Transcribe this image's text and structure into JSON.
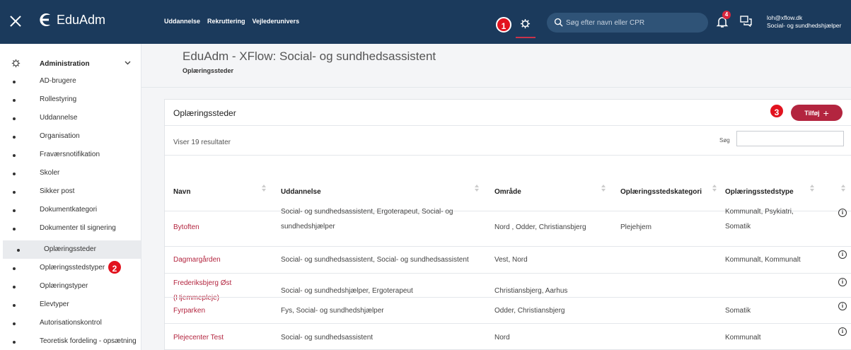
{
  "topbar": {
    "brand": "EduAdm",
    "nav": [
      "Uddannelse",
      "Rekruttering",
      "Vejlederunivers"
    ],
    "search_placeholder": "Søg efter navn eller CPR",
    "notifications_count": "4",
    "user_email": "loh@xflow.dk",
    "user_role": "Social- og sundhedshjælper"
  },
  "sidebar": {
    "section_label": "Administration",
    "items": [
      "AD-brugere",
      "Rollestyring",
      "Uddannelse",
      "Organisation",
      "Fraværsnotifikation",
      "Skoler",
      "Sikker post",
      "Dokumentkategori",
      "Dokumenter til signering",
      "Oplæringssteder",
      "Oplæringsstedstyper",
      "Oplæringstyper",
      "Elevtyper",
      "Autorisationskontrol",
      "Teoretisk fordeling - opsætning"
    ],
    "active_item": "Oplæringssteder"
  },
  "page": {
    "title": "EduAdm - XFlow: Social- og sundhedsassistent",
    "subtitle": "Oplæringssteder"
  },
  "card": {
    "title": "Oplæringssteder",
    "add_label": "Tilføj",
    "result_count": "Viser 19 resultater",
    "search_label": "Søg",
    "columns": [
      "Navn",
      "Uddannelse",
      "Område",
      "Oplæringsstedskategori",
      "Oplæringsstedstype"
    ],
    "rows": [
      {
        "name": "Bytoften",
        "uddannelse": [
          "Social- og sundhedsassistent, Ergoterapeut, Social- og",
          "sundhedshjælper"
        ],
        "omraade": "Nord , Odder, Christiansbjerg",
        "kategori": "Plejehjem",
        "type": [
          "Kommunalt, Psykiatri,",
          "Somatik"
        ]
      },
      {
        "name": "Dagmargården",
        "uddannelse": [
          "Social- og sundhedsassistent, Social- og sundhedsassistent"
        ],
        "omraade": "Vest, Nord",
        "kategori": "",
        "type": [
          "Kommunalt, Kommunalt"
        ]
      },
      {
        "name": [
          "Frederiksbjerg Øst",
          "(Hjemmepleje)"
        ],
        "uddannelse": [
          "Social- og sundhedshjælper, Ergoterapeut"
        ],
        "omraade": "Christiansbjerg, Aarhus",
        "kategori": "",
        "type": []
      },
      {
        "name": "Fyrparken",
        "uddannelse": [
          "Fys, Social- og sundhedshjælper"
        ],
        "omraade": "Odder, Christiansbjerg",
        "kategori": "",
        "type": [
          "Somatik"
        ]
      },
      {
        "name": "Plejecenter Test",
        "uddannelse": [
          "Social- og sundhedsassistent"
        ],
        "omraade": "Nord",
        "kategori": "",
        "type": [
          "Kommunalt"
        ]
      }
    ]
  },
  "markers": [
    "1",
    "2",
    "3"
  ],
  "colors": {
    "topbar_bg": "#1b3a5c",
    "accent": "#b3253f",
    "marker": "#e2131f"
  }
}
